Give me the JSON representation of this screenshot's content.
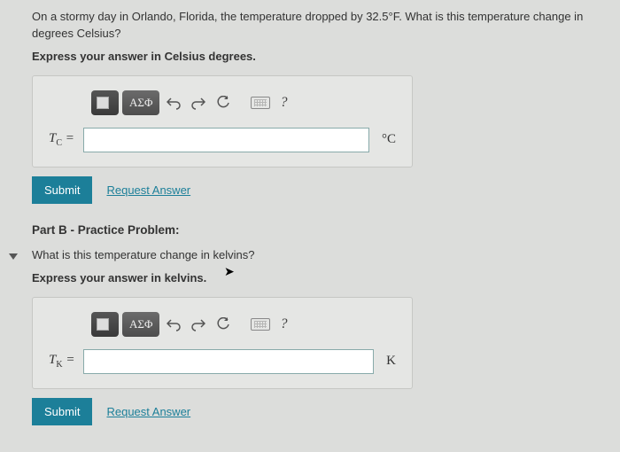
{
  "partA": {
    "question": "On a stormy day in Orlando, Florida, the temperature dropped by 32.5°F. What is this temperature change in degrees Celsius?",
    "instruction": "Express your answer in Celsius degrees.",
    "greek": "ΑΣΦ",
    "help": "?",
    "var_html": "T",
    "var_sub": "C",
    "equals": " =",
    "unit": "°C",
    "submit": "Submit",
    "request": "Request Answer"
  },
  "partB": {
    "header": "Part B - Practice Problem:",
    "question": "What is this temperature change in kelvins?",
    "instruction": "Express your answer in kelvins.",
    "greek": "ΑΣΦ",
    "help": "?",
    "var_html": "T",
    "var_sub": "K",
    "equals": " =",
    "unit": "K",
    "submit": "Submit",
    "request": "Request Answer"
  }
}
